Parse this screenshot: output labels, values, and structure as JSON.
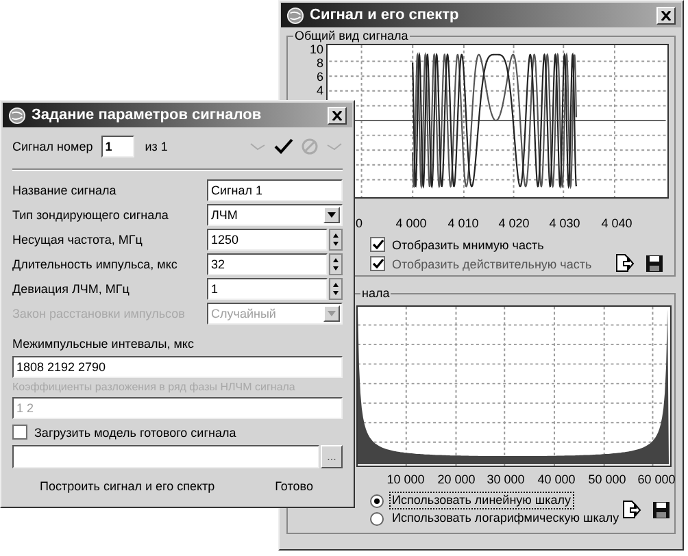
{
  "spectrum_window": {
    "title": "Сигнал и его спектр",
    "signal_group": {
      "title": "Общий вид сигнала",
      "yticks": [
        "10",
        "8",
        "6",
        "4"
      ],
      "xticks": [
        "0",
        "4 000",
        "4 010",
        "4 020",
        "4 030",
        "4 040"
      ],
      "checkboxes": [
        {
          "label": "Отобразить мнимую часть",
          "checked": true
        },
        {
          "label": "Отобразить действительную часть",
          "checked": true
        }
      ]
    },
    "spectrum_group": {
      "title": "нала",
      "xticks": [
        "10 000",
        "20 000",
        "30 000",
        "40 000",
        "50 000",
        "60 000"
      ],
      "radios": [
        {
          "label": "Использовать линейную шкалу",
          "selected": true
        },
        {
          "label": "Использовать логарифмическую шкалу",
          "selected": false
        }
      ]
    }
  },
  "params_window": {
    "title": "Задание параметров сигналов",
    "signal_number": {
      "label": "Сигнал номер",
      "value": "1",
      "total": "из 1"
    },
    "fields": [
      {
        "label": "Название сигнала",
        "value": "Сигнал 1",
        "kind": "text",
        "disabled": false
      },
      {
        "label": "Тип зондирующего сигнала",
        "value": "ЛЧМ",
        "kind": "select",
        "disabled": false
      },
      {
        "label": "Несущая частота, МГц",
        "value": "1250",
        "kind": "spin",
        "disabled": false
      },
      {
        "label": "Длительность импульса, мкс",
        "value": "32",
        "kind": "spin",
        "disabled": false
      },
      {
        "label": "Девиация ЛЧМ, МГц",
        "value": "1",
        "kind": "spin",
        "disabled": false
      },
      {
        "label": "Закон расстановки импульсов",
        "value": "Случайный",
        "kind": "select",
        "disabled": true
      }
    ],
    "intervals": {
      "label": "Межимпульсные интевалы, мкс",
      "value": "1808 2192 2790",
      "disabled": false
    },
    "coefficients": {
      "label": "Коэффициенты разложения в ряд фазы НЛЧМ сигнала",
      "value": "1 2",
      "disabled": true
    },
    "load_model": {
      "label": "Загрузить модель готового сигнала",
      "checked": false
    },
    "browse": "...",
    "buttons": [
      "Построить сигнал и его спектр",
      "Готово"
    ]
  }
}
